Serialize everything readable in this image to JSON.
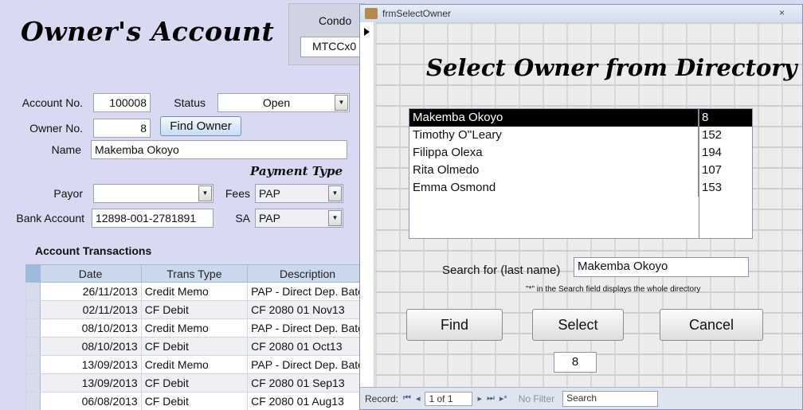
{
  "form": {
    "title": "Owner's Account",
    "condo_label": "Condo",
    "condo_value": "MTCCx0",
    "account_no_label": "Account No.",
    "account_no_value": "100008",
    "status_label": "Status",
    "status_value": "Open",
    "owner_no_label": "Owner No.",
    "owner_no_value": "8",
    "find_owner_label": "Find Owner",
    "name_label": "Name",
    "name_value": "Makemba Okoyo",
    "payment_type_label": "Payment Type",
    "payor_label": "Payor",
    "payor_value": "",
    "fees_label": "Fees",
    "fees_value": "PAP",
    "bank_account_label": "Bank Account",
    "bank_account_value": "12898-001-2781891",
    "sa_label": "SA",
    "sa_value": "PAP"
  },
  "transactions": {
    "title": "Account Transactions",
    "headers": [
      "Date",
      "Trans Type",
      "Description"
    ],
    "rows": [
      {
        "date": "26/11/2013",
        "type": "Credit Memo",
        "desc": "PAP - Direct Dep. Bato"
      },
      {
        "date": "02/11/2013",
        "type": "CF Debit",
        "desc": "CF 2080 01  Nov13"
      },
      {
        "date": "08/10/2013",
        "type": "Credit Memo",
        "desc": "PAP - Direct Dep. Bato"
      },
      {
        "date": "08/10/2013",
        "type": "CF Debit",
        "desc": "CF 2080 01  Oct13"
      },
      {
        "date": "13/09/2013",
        "type": "Credit Memo",
        "desc": "PAP - Direct Dep. Bato"
      },
      {
        "date": "13/09/2013",
        "type": "CF Debit",
        "desc": "CF 2080 01  Sep13"
      },
      {
        "date": "06/08/2013",
        "type": "CF Debit",
        "desc": "CF 2080 01  Aug13"
      }
    ]
  },
  "dialog": {
    "window_title": "frmSelectOwner",
    "close_glyph": "×",
    "heading": "Select Owner from Directory",
    "owners": [
      {
        "name": "Makemba Okoyo",
        "no": "8",
        "selected": true
      },
      {
        "name": "Timothy O''Leary",
        "no": "152"
      },
      {
        "name": "Filippa Olexa",
        "no": "194"
      },
      {
        "name": "Rita Olmedo",
        "no": "107"
      },
      {
        "name": "Emma Osmond",
        "no": "153"
      }
    ],
    "search_label": "Search for (last name)",
    "search_value": "Makemba Okoyo",
    "search_hint": "\"*\" in the Search field displays the whole directory",
    "find_label": "Find",
    "select_label": "Select",
    "cancel_label": "Cancel",
    "owner_no_value": "8"
  },
  "navbar": {
    "record_label": "Record:",
    "first_glyph": "⏮",
    "prev_glyph": "◂",
    "position": "1 of 1",
    "next_glyph": "▸",
    "last_glyph": "⏭",
    "new_glyph": "▸*",
    "filter_label": "No Filter",
    "search_placeholder": "Search"
  },
  "icons": {
    "combo_arrow": "▼"
  }
}
